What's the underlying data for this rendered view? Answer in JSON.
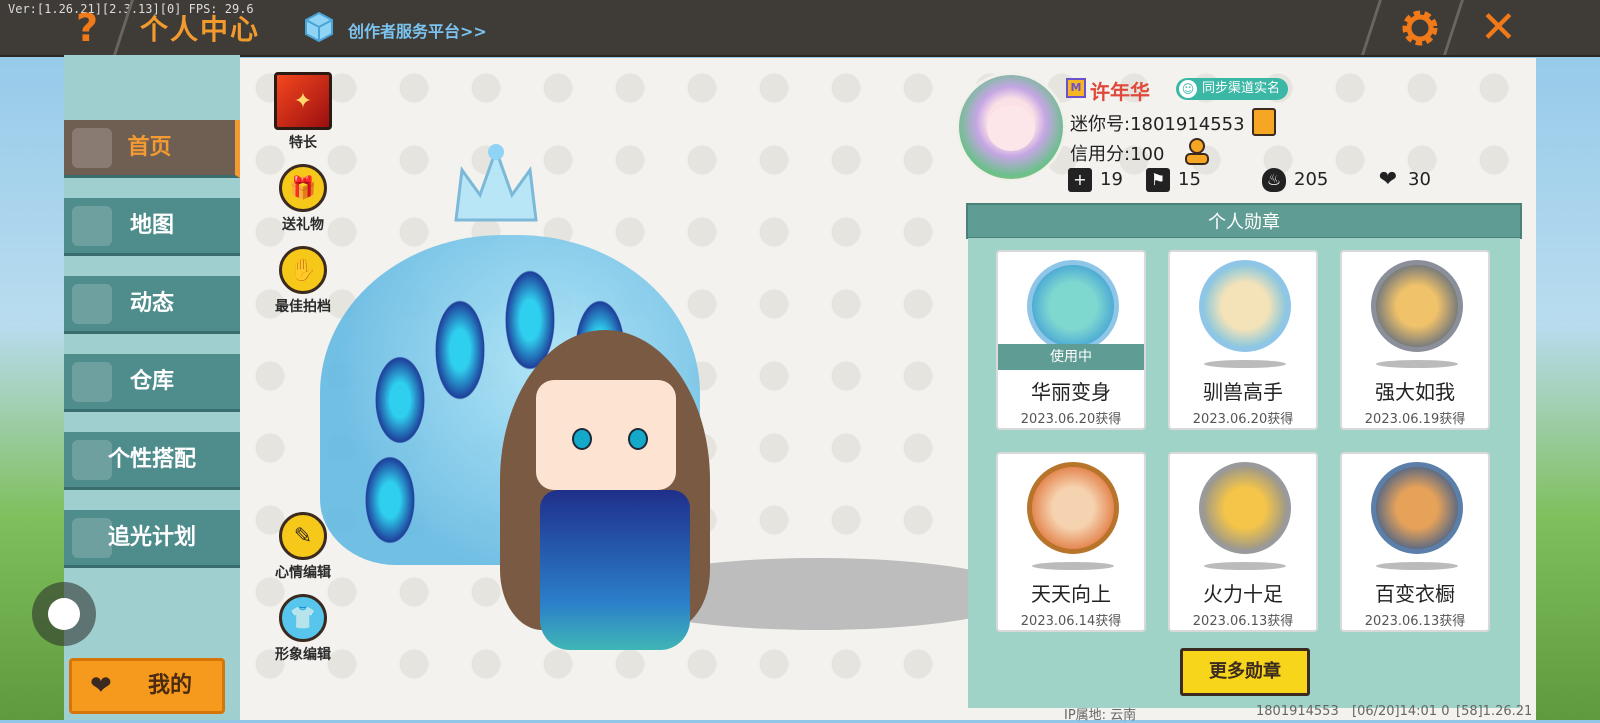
{
  "version_text": "Ver:[1.26.21][2.3.13][0] FPS: 29.6",
  "header": {
    "title": "个人中心",
    "creator_link": "创作者服务平台>>",
    "help_glyph": "?",
    "close_glyph": "✕"
  },
  "nav": {
    "items": [
      {
        "label": "首页",
        "active": true
      },
      {
        "label": "地图"
      },
      {
        "label": "动态"
      },
      {
        "label": "仓库"
      },
      {
        "label": "个性搭配"
      },
      {
        "label": "追光计划"
      }
    ],
    "mine_label": "我的"
  },
  "tools": {
    "specialty": "特长",
    "send_gift": "送礼物",
    "best_partner": "最佳拍档",
    "mood_edit": "心情编辑",
    "avatar_edit": "形象编辑"
  },
  "profile": {
    "username": "许年华",
    "realname_badge": "同步渠道实名",
    "mini_id": "迷你号:1801914553",
    "credit": "信用分:100",
    "stats": {
      "follow": "19",
      "fans": "15",
      "hot": "205",
      "likes": "30"
    }
  },
  "medals": {
    "header": "个人勋章",
    "in_use_label": "使用中",
    "items": [
      {
        "name": "华丽变身",
        "date": "2023.06.20获得",
        "in_use": true
      },
      {
        "name": "驯兽高手",
        "date": "2023.06.20获得"
      },
      {
        "name": "强大如我",
        "date": "2023.06.19获得"
      },
      {
        "name": "天天向上",
        "date": "2023.06.14获得"
      },
      {
        "name": "火力十足",
        "date": "2023.06.13获得"
      },
      {
        "name": "百变衣橱",
        "date": "2023.06.13获得"
      }
    ],
    "more_label": "更多勋章"
  },
  "footer": {
    "ip": "IP属地: 云南",
    "uid": "1801914553",
    "time": "[06/20]14:01 0",
    "build": "[58]1.26.21"
  },
  "colors": {
    "accent": "#f29a2e",
    "nav_bg": "#4f8c8c",
    "medal_header": "#5f9c94",
    "more_button": "#f7d51b"
  }
}
